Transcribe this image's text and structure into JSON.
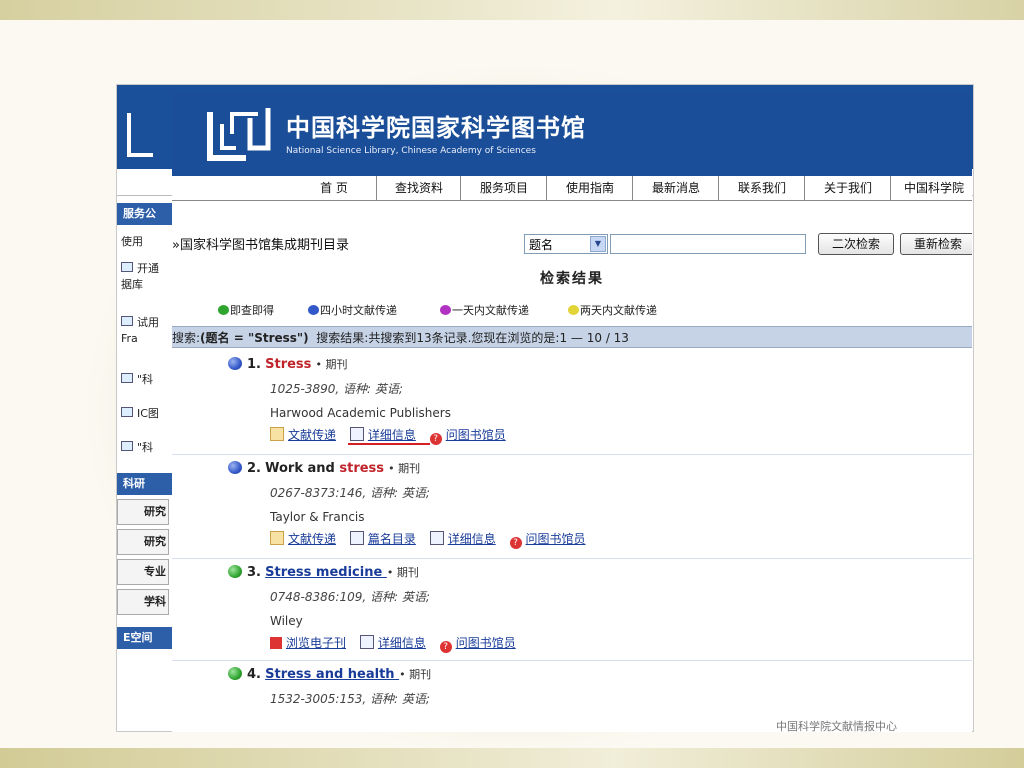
{
  "header": {
    "title": "中国科学院国家科学图书馆",
    "subtitle": "National Science Library, Chinese Academy of Sciences"
  },
  "nav": [
    "首 页",
    "查找资料",
    "服务项目",
    "使用指南",
    "最新消息",
    "联系我们",
    "关于我们",
    "中国科学院"
  ],
  "back_sidebar": {
    "head1": "服务公",
    "item0": "使用",
    "items": [
      "开通\n据库",
      "试用\nFra",
      "\"科",
      "IC图",
      "\"科"
    ],
    "head2": "科研",
    "buttons": [
      "研究",
      "研究",
      "专业",
      "学科"
    ],
    "head3": "E空间"
  },
  "breadcrumb": "»国家科学图书馆集成期刊目录",
  "search": {
    "field_selected": "题名",
    "keyword_value": "",
    "btn_secondary": "二次检索",
    "btn_new": "重新检索"
  },
  "results_title": "检索结果",
  "legend": [
    {
      "label": "即查即得",
      "color": "#2fa52f"
    },
    {
      "label": "四小时文献传递",
      "color": "#3358c9"
    },
    {
      "label": "一天内文献传递",
      "color": "#b032c0"
    },
    {
      "label": "两天内文献传递",
      "color": "#e3d438"
    }
  ],
  "summary": {
    "prefix": "搜索:",
    "query": "(题名 = \"Stress\")",
    "text": "搜索结果:共搜索到13条记录.您现在浏览的是:1 — 10 / 13"
  },
  "records": [
    {
      "num": "1.",
      "title": "Stress",
      "kind": "• 期刊",
      "issn": "1025-3890, 语种: 英语;",
      "publisher": "Harwood Academic Publishers",
      "actions": [
        "文献传递",
        "详细信息",
        "问图书馆员"
      ],
      "ball": "#3358c9"
    },
    {
      "num": "2.",
      "title_pre": "Work and ",
      "title": "stress",
      "kind": "• 期刊",
      "issn": "0267-8373:146, 语种: 英语;",
      "publisher": "Taylor & Francis",
      "actions": [
        "文献传递",
        "篇名目录",
        "详细信息",
        "问图书馆员"
      ],
      "ball": "#3358c9"
    },
    {
      "num": "3.",
      "title": "Stress medicine ",
      "kind": "• 期刊",
      "issn": "0748-8386:109, 语种: 英语;",
      "publisher": "Wiley",
      "actions": [
        "浏览电子刊",
        "详细信息",
        "问图书馆员"
      ],
      "ball": "#2fa52f"
    },
    {
      "num": "4.",
      "title": "Stress and health ",
      "kind": "• 期刊",
      "issn": "1532-3005:153, 语种: 英语;",
      "publisher": "",
      "actions": [],
      "ball": "#2fa52f"
    }
  ],
  "bottom_text": "中国科学院文献情报中心"
}
